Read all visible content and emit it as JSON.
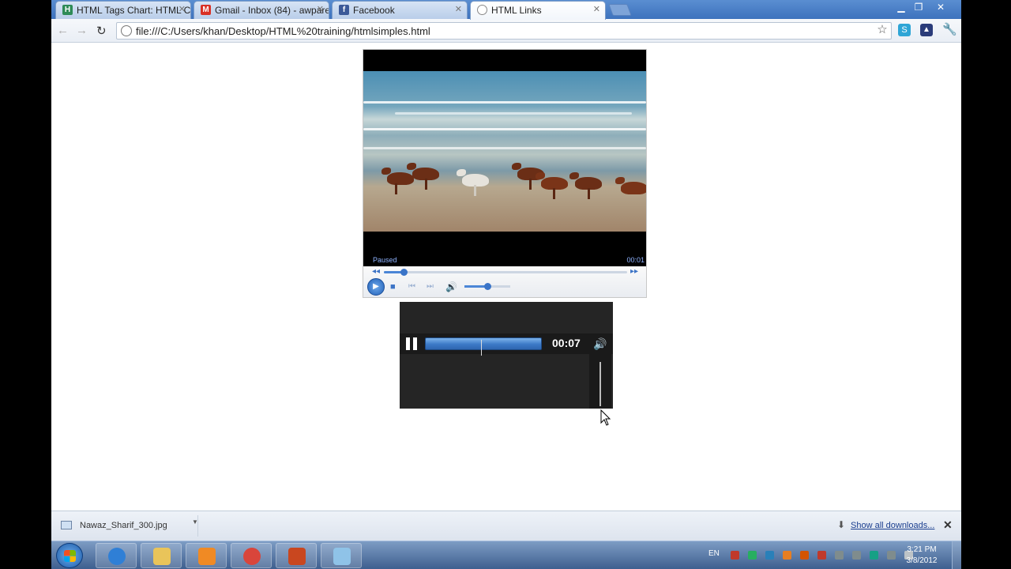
{
  "browser": {
    "tabs": [
      {
        "label": "HTML Tags Chart: HTML C",
        "favicon_color": "#2e8b57",
        "favicon_letter": "H"
      },
      {
        "label": "Gmail - Inbox (84) - awpare",
        "favicon_color": "#d93025",
        "favicon_letter": "M"
      },
      {
        "label": "Facebook",
        "favicon_color": "#3b5998",
        "favicon_letter": "f"
      },
      {
        "label": "HTML Links",
        "favicon_color": "#888888",
        "favicon_letter": ""
      }
    ],
    "active_tab": 3,
    "url": "file:///C:/Users/khan/Desktop/HTML%20training/htmlsimples.html"
  },
  "video_player": {
    "status": "Paused",
    "time": "00:01",
    "seek_fraction": 0.08,
    "volume_fraction": 0.5
  },
  "audio_player": {
    "time": "00:07"
  },
  "downloads": {
    "file_name": "Nawaz_Sharif_300.jpg",
    "show_all": "Show all downloads..."
  },
  "taskbar": {
    "language": "EN",
    "clock_time": "3:21 PM",
    "clock_date": "3/8/2012",
    "pinned": [
      {
        "name": "internet-explorer",
        "color": "#2f7fd6"
      },
      {
        "name": "windows-explorer",
        "color": "#e9c45a"
      },
      {
        "name": "media-player",
        "color": "#f08a24"
      },
      {
        "name": "chrome",
        "color": "#d9453b"
      },
      {
        "name": "html-editor",
        "color": "#c9471f"
      },
      {
        "name": "notepad",
        "color": "#8fc3e8"
      }
    ],
    "tray_colors": [
      "#c0392b",
      "#27ae60",
      "#2980b9",
      "#e67e22",
      "#d35400",
      "#c0392b",
      "#7f8c8d",
      "#7f8c8d",
      "#16a085",
      "#7f8c8d",
      "#bdc3c7"
    ]
  }
}
